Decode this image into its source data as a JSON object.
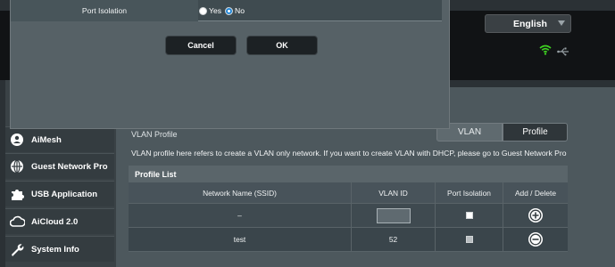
{
  "header": {
    "language": "English"
  },
  "sidebar": {
    "items": [
      {
        "label": "AiMesh",
        "icon": "aimesh-icon"
      },
      {
        "label": "Guest Network Pro",
        "icon": "globe-icon"
      },
      {
        "label": "USB Application",
        "icon": "puzzle-icon"
      },
      {
        "label": "AiCloud 2.0",
        "icon": "cloud-icon"
      },
      {
        "label": "System Info",
        "icon": "wrench-icon"
      }
    ]
  },
  "vlan": {
    "tabs": [
      "VLAN",
      "Profile"
    ],
    "active_tab": "Profile",
    "title": "VLAN Profile",
    "description": "VLAN profile here refers to create a VLAN only network. If you want to create VLAN with DHCP, please go to Guest Network Pro",
    "profile_list": {
      "heading": "Profile List",
      "columns": [
        "Network Name (SSID)",
        "VLAN ID",
        "Port Isolation",
        "Add / Delete"
      ],
      "rows": [
        {
          "ssid": "–",
          "vlan_id": "",
          "port_isolation": false,
          "action": "add"
        },
        {
          "ssid": "test",
          "vlan_id": "52",
          "port_isolation": false,
          "action": "delete"
        }
      ]
    }
  },
  "modal": {
    "port_isolation_label": "Port Isolation",
    "options": [
      "Yes",
      "No"
    ],
    "selected": "No",
    "cancel_label": "Cancel",
    "ok_label": "OK"
  },
  "colors": {
    "accent_blue": "#1f86d8",
    "wifi_green": "#3ed321",
    "panel": "#4d585d",
    "modal": "#566166"
  }
}
